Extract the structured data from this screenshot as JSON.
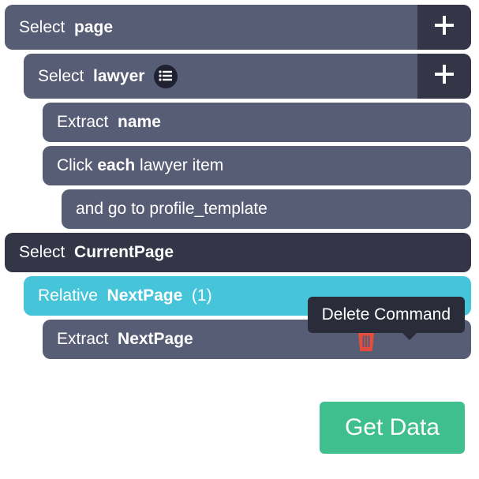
{
  "rows": {
    "select_page": {
      "prefix": "Select  ",
      "bold": "page"
    },
    "select_lawyer": {
      "prefix": "Select  ",
      "bold": "lawyer"
    },
    "extract_name": {
      "prefix": "Extract  ",
      "bold": "name"
    },
    "click_each": {
      "prefix": "Click ",
      "bold": "each",
      "suffix": " lawyer item"
    },
    "goto": {
      "text": "and go to profile_template"
    },
    "select_cp": {
      "prefix": "Select  ",
      "bold": "CurrentPage"
    },
    "relative_np": {
      "prefix": "Relative  ",
      "bold": "NextPage",
      "suffix": "  (1)"
    },
    "extract_np": {
      "prefix": "Extract  ",
      "bold": "NextPage"
    }
  },
  "tooltip": "Delete Command",
  "get_data": "Get Data",
  "colors": {
    "slate": "#585d76",
    "dark": "#343648",
    "cyan": "#46c4da",
    "green": "#3fbf8e",
    "trash": "#e74c3c"
  }
}
